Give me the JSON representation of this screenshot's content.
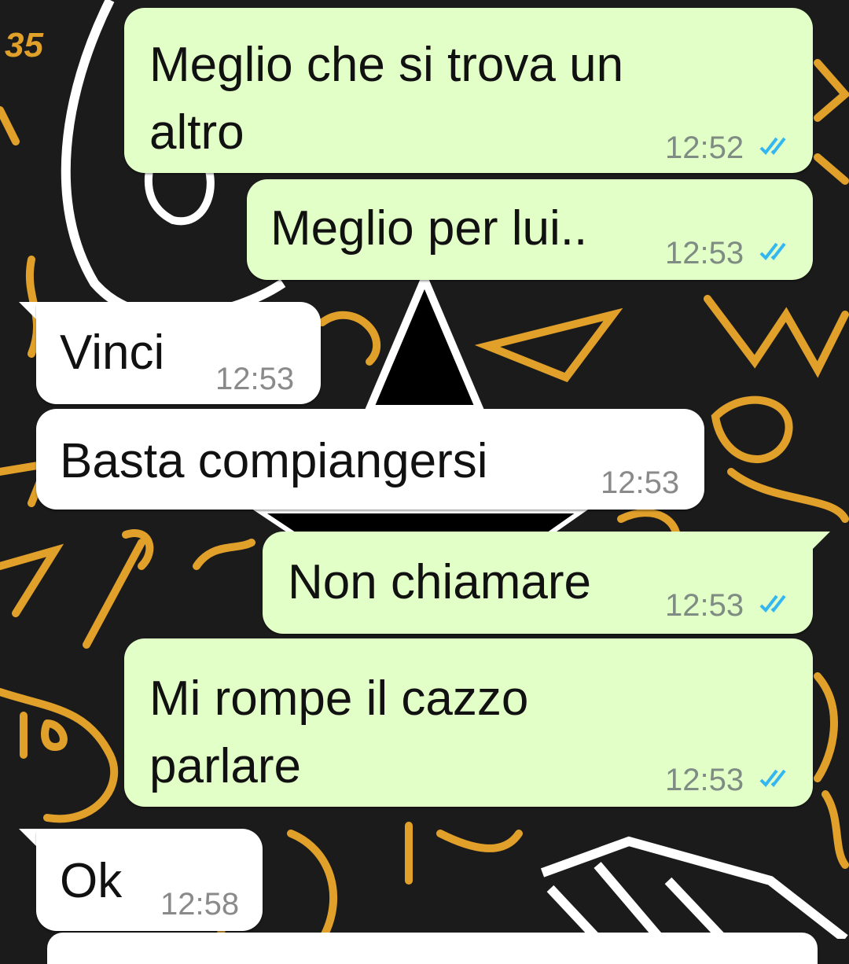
{
  "chat": {
    "messages": [
      {
        "direction": "outgoing",
        "text": "Meglio che si trova un\naltro",
        "time": "12:52",
        "status": "read"
      },
      {
        "direction": "outgoing",
        "text": "Meglio per lui..",
        "time": "12:53",
        "status": "read"
      },
      {
        "direction": "incoming",
        "text": "Vinci",
        "time": "12:53"
      },
      {
        "direction": "incoming",
        "text": "Basta compiangersi",
        "time": "12:53"
      },
      {
        "direction": "outgoing",
        "text": "Non chiamare",
        "time": "12:53",
        "status": "read"
      },
      {
        "direction": "outgoing",
        "text": "Mi rompe il cazzo\nparlare",
        "time": "12:53",
        "status": "read"
      },
      {
        "direction": "incoming",
        "text": "Ok",
        "time": "12:58"
      }
    ]
  },
  "wallpaper": {
    "corner_number": "35"
  },
  "colors": {
    "outgoing_bubble": "#e2ffc7",
    "incoming_bubble": "#ffffff",
    "read_ticks": "#34b7f1",
    "wallpaper_bg": "#1b1b1b",
    "doodle_orange": "#e0a02a"
  },
  "icons": {
    "read_receipt": "double-check-icon"
  }
}
